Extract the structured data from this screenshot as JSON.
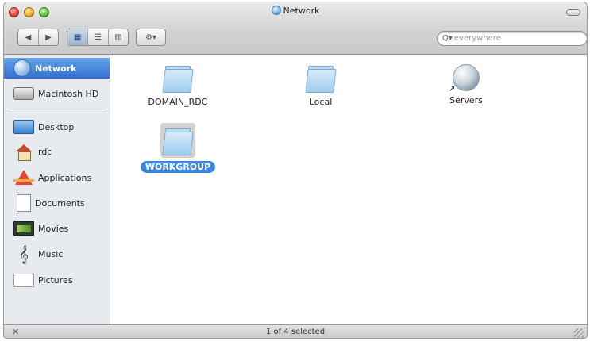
{
  "window": {
    "title": "Network"
  },
  "toolbar": {
    "back_icon": "back-arrow-icon",
    "forward_icon": "forward-arrow-icon",
    "view_modes": [
      "icon",
      "list",
      "column"
    ],
    "active_view": "icon",
    "action_icon": "gear-icon",
    "search_placeholder": "everywhere"
  },
  "sidebar": {
    "items": [
      {
        "label": "Network",
        "icon": "network-globe-icon",
        "selected": true
      },
      {
        "label": "Macintosh HD",
        "icon": "hard-drive-icon",
        "selected": false
      },
      {
        "label": "Desktop",
        "icon": "desktop-icon",
        "selected": false
      },
      {
        "label": "rdc",
        "icon": "home-icon",
        "selected": false
      },
      {
        "label": "Applications",
        "icon": "applications-icon",
        "selected": false
      },
      {
        "label": "Documents",
        "icon": "documents-icon",
        "selected": false
      },
      {
        "label": "Movies",
        "icon": "movies-icon",
        "selected": false
      },
      {
        "label": "Music",
        "icon": "music-icon",
        "selected": false
      },
      {
        "label": "Pictures",
        "icon": "pictures-icon",
        "selected": false
      }
    ]
  },
  "main": {
    "items": [
      {
        "label": "DOMAIN_RDC",
        "kind": "folder",
        "selected": false
      },
      {
        "label": "Local",
        "kind": "folder",
        "selected": false
      },
      {
        "label": "Servers",
        "kind": "alias-globe",
        "selected": false
      },
      {
        "label": "WORKGROUP",
        "kind": "folder",
        "selected": true
      }
    ]
  },
  "status": {
    "text": "1 of 4 selected"
  },
  "colors": {
    "selection": "#3b86e0",
    "sidebar_bg": "#e7ebf0"
  }
}
